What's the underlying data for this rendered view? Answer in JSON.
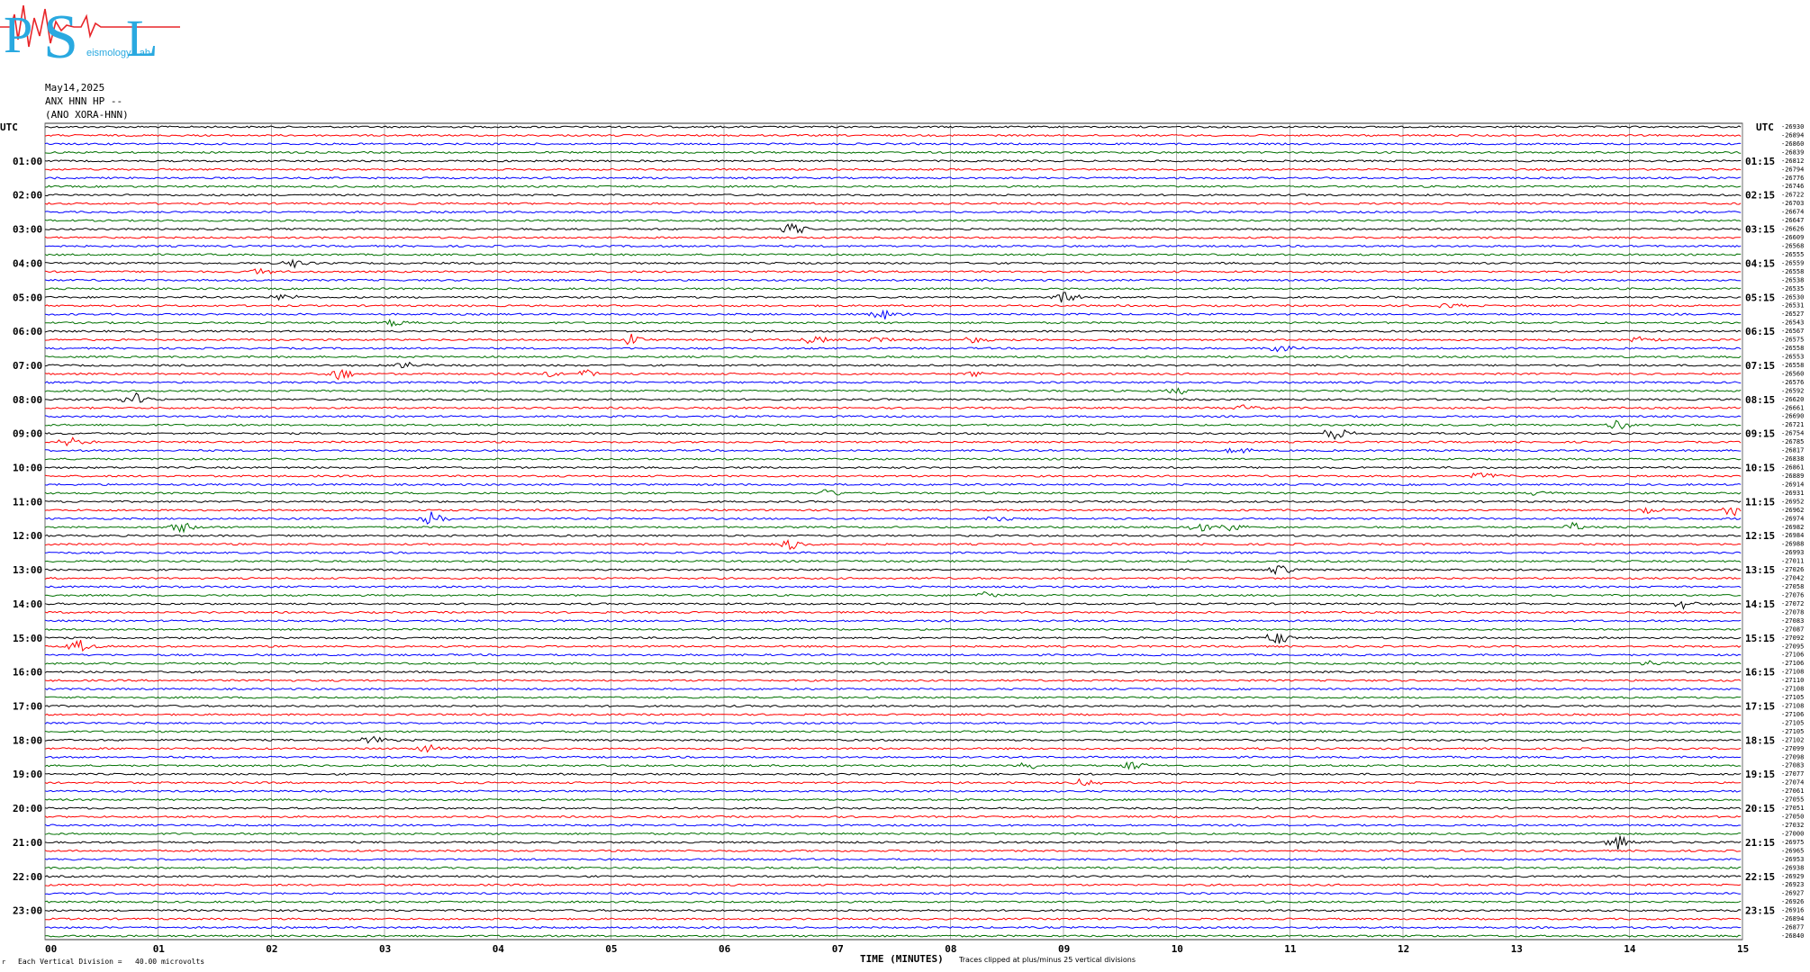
{
  "logo": {
    "letters": [
      "P",
      "S",
      "L"
    ],
    "text": "eismology Lab",
    "color": "#29a9e0",
    "wave_color": "#e8262a"
  },
  "header": {
    "date": "May14,2025",
    "station_line": "ANX HNN HP --",
    "channel_line": "(ANO XORA-HNN)"
  },
  "labels": {
    "utc_left": "UTC",
    "utc_right": "UTC",
    "x_axis_title": "TIME (MINUTES)",
    "vertical_division": "Each Vertical Division =   40.00 microvolts",
    "clip_note": "Traces clipped at plus/minus 25 vertical divisions",
    "corner_mark": "r"
  },
  "chart_data": {
    "type": "line",
    "title": "",
    "xlabel": "TIME (MINUTES)",
    "ylabel": "",
    "xlim": [
      0,
      15
    ],
    "x_ticks": [
      "00",
      "01",
      "02",
      "03",
      "04",
      "05",
      "06",
      "07",
      "08",
      "09",
      "10",
      "11",
      "12",
      "13",
      "14",
      "15"
    ],
    "hours_left": [
      "01:00",
      "02:00",
      "03:00",
      "04:00",
      "05:00",
      "06:00",
      "07:00",
      "08:00",
      "09:00",
      "10:00",
      "11:00",
      "12:00",
      "13:00",
      "14:00",
      "15:00",
      "16:00",
      "17:00",
      "18:00",
      "19:00",
      "20:00",
      "21:00",
      "22:00",
      "23:00"
    ],
    "hours_right": [
      "01:15",
      "02:15",
      "03:15",
      "04:15",
      "05:15",
      "06:15",
      "07:15",
      "08:15",
      "09:15",
      "10:15",
      "11:15",
      "12:15",
      "13:15",
      "14:15",
      "15:15",
      "16:15",
      "17:15",
      "18:15",
      "19:15",
      "20:15",
      "21:15",
      "22:15",
      "23:15"
    ],
    "trace_colors": [
      "#000000",
      "#ff0000",
      "#0000ff",
      "#007000"
    ],
    "trace_count": 96,
    "offsets": [
      -26930,
      -26894,
      -26860,
      -26839,
      -26812,
      -26794,
      -26776,
      -26746,
      -26722,
      -26703,
      -26674,
      -26647,
      -26626,
      -26609,
      -26568,
      -26555,
      -26559,
      -26558,
      -26538,
      -26535,
      -26530,
      -26531,
      -26527,
      -26543,
      -26567,
      -26575,
      -26558,
      -26553,
      -26558,
      -26560,
      -26576,
      -26592,
      -26620,
      -26661,
      -26690,
      -26721,
      -26754,
      -26785,
      -26817,
      -26838,
      -26861,
      -26889,
      -26914,
      -26931,
      -26952,
      -26962,
      -26974,
      -26982,
      -26984,
      -26988,
      -26993,
      -27011,
      -27026,
      -27042,
      -27058,
      -27076,
      -27072,
      -27078,
      -27083,
      -27087,
      -27092,
      -27095,
      -27106,
      -27106,
      -27108,
      -27110,
      -27108,
      -27105,
      -27108,
      -27106,
      -27105,
      -27105,
      -27102,
      -27099,
      -27098,
      -27083,
      -27077,
      -27074,
      -27061,
      -27055,
      -27051,
      -27050,
      -27032,
      -27000,
      -26975,
      -26965,
      -26953,
      -26938,
      -26929,
      -26923,
      -26927,
      -26926,
      -26916,
      -26894,
      -26877,
      -26840
    ],
    "events": [
      {
        "trace": 12,
        "minute": 6.6,
        "amp": 1.4
      },
      {
        "trace": 16,
        "minute": 2.2,
        "amp": 0.9
      },
      {
        "trace": 17,
        "minute": 1.9,
        "amp": 0.8
      },
      {
        "trace": 20,
        "minute": 9.0,
        "amp": 1.6
      },
      {
        "trace": 20,
        "minute": 2.1,
        "amp": 0.8
      },
      {
        "trace": 21,
        "minute": 12.4,
        "amp": 0.7
      },
      {
        "trace": 22,
        "minute": 7.4,
        "amp": 1.2
      },
      {
        "trace": 23,
        "minute": 3.1,
        "amp": 0.9
      },
      {
        "trace": 25,
        "minute": 5.2,
        "amp": 1.3
      },
      {
        "trace": 25,
        "minute": 6.8,
        "amp": 1.1
      },
      {
        "trace": 25,
        "minute": 7.4,
        "amp": 1.0
      },
      {
        "trace": 25,
        "minute": 8.2,
        "amp": 0.8
      },
      {
        "trace": 25,
        "minute": 14.1,
        "amp": 0.6
      },
      {
        "trace": 26,
        "minute": 10.9,
        "amp": 1.0
      },
      {
        "trace": 28,
        "minute": 3.2,
        "amp": 0.9
      },
      {
        "trace": 29,
        "minute": 2.6,
        "amp": 1.4
      },
      {
        "trace": 29,
        "minute": 4.5,
        "amp": 0.8
      },
      {
        "trace": 29,
        "minute": 4.8,
        "amp": 0.9
      },
      {
        "trace": 29,
        "minute": 8.2,
        "amp": 0.7
      },
      {
        "trace": 31,
        "minute": 10.0,
        "amp": 0.9
      },
      {
        "trace": 32,
        "minute": 0.8,
        "amp": 1.3
      },
      {
        "trace": 33,
        "minute": 10.6,
        "amp": 0.7
      },
      {
        "trace": 35,
        "minute": 13.9,
        "amp": 1.2
      },
      {
        "trace": 36,
        "minute": 11.4,
        "amp": 1.3
      },
      {
        "trace": 37,
        "minute": 0.2,
        "amp": 1.2
      },
      {
        "trace": 38,
        "minute": 10.5,
        "amp": 0.9
      },
      {
        "trace": 41,
        "minute": 12.7,
        "amp": 0.9
      },
      {
        "trace": 43,
        "minute": 6.9,
        "amp": 1.0
      },
      {
        "trace": 43,
        "minute": 13.2,
        "amp": 0.7
      },
      {
        "trace": 45,
        "minute": 14.2,
        "amp": 0.8
      },
      {
        "trace": 45,
        "minute": 14.9,
        "amp": 1.3
      },
      {
        "trace": 46,
        "minute": 3.4,
        "amp": 2.0
      },
      {
        "trace": 46,
        "minute": 8.4,
        "amp": 0.9
      },
      {
        "trace": 47,
        "minute": 1.2,
        "amp": 1.3
      },
      {
        "trace": 47,
        "minute": 10.2,
        "amp": 1.0
      },
      {
        "trace": 47,
        "minute": 10.5,
        "amp": 1.0
      },
      {
        "trace": 47,
        "minute": 13.5,
        "amp": 0.9
      },
      {
        "trace": 49,
        "minute": 6.6,
        "amp": 1.4
      },
      {
        "trace": 52,
        "minute": 10.9,
        "amp": 1.1
      },
      {
        "trace": 55,
        "minute": 8.3,
        "amp": 0.9
      },
      {
        "trace": 56,
        "minute": 14.5,
        "amp": 1.2
      },
      {
        "trace": 60,
        "minute": 10.9,
        "amp": 1.4
      },
      {
        "trace": 61,
        "minute": 0.3,
        "amp": 1.3
      },
      {
        "trace": 63,
        "minute": 14.2,
        "amp": 0.8
      },
      {
        "trace": 72,
        "minute": 2.9,
        "amp": 0.9
      },
      {
        "trace": 73,
        "minute": 3.4,
        "amp": 1.1
      },
      {
        "trace": 75,
        "minute": 8.7,
        "amp": 0.9
      },
      {
        "trace": 75,
        "minute": 9.6,
        "amp": 1.0
      },
      {
        "trace": 77,
        "minute": 9.2,
        "amp": 1.1
      },
      {
        "trace": 84,
        "minute": 13.9,
        "amp": 1.6
      }
    ]
  }
}
